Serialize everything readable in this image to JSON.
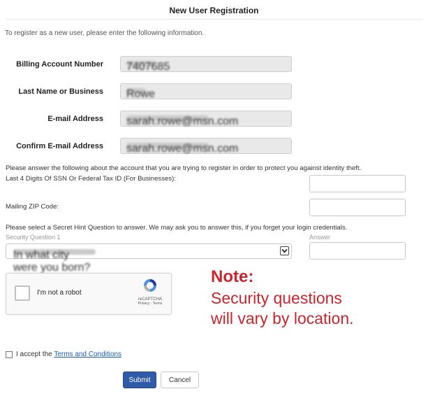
{
  "header": {
    "title": "New User Registration",
    "intro": "To register as a new user, please enter the following information."
  },
  "account_fields": [
    {
      "label": "Billing Account Number",
      "blurred_value": "7407685"
    },
    {
      "label": "Last Name or Business",
      "blurred_value": "Rowe"
    },
    {
      "label": "E-mail Address",
      "blurred_value": "sarah.rowe@msn.com"
    },
    {
      "label": "Confirm E-mail Address",
      "blurred_value": "sarah.rowe@msn.com"
    }
  ],
  "identity": {
    "intro": "Please answer the following about the account that you are trying to register in order to protect you against identity theft.",
    "ssn_label": "Last 4 Digits Of SSN Or Federal Tax ID (For Businesses):",
    "ssn_value": "",
    "zip_label": "Mailing ZIP Code:",
    "zip_value": ""
  },
  "security": {
    "intro": "Please select a Secret Hint Question to answer. We may ask you to answer this, if you forget your login credentials.",
    "question_label": "Security Question 1",
    "question_selected": "In what city were you born?",
    "answer_label": "Answer",
    "answer_value": ""
  },
  "captcha": {
    "label": "I'm not a robot",
    "brand": "reCAPTCHA",
    "links": "Privacy - Terms"
  },
  "note": {
    "heading": "Note:",
    "line1": "Security questions",
    "line2": "will vary by location."
  },
  "terms": {
    "prefix": "I accept the",
    "link": "Terms and Conditions"
  },
  "buttons": {
    "submit": "Submit",
    "cancel": "Cancel"
  },
  "colors": {
    "note": "#c8262c",
    "submit_bg": "#2e5aa8",
    "link": "#1a5fb4",
    "readonly_field_bg": "#e9e9e9"
  },
  "icons": {
    "select_arrow": "chevron-down-icon",
    "captcha_logo": "recaptcha-logo-icon"
  }
}
